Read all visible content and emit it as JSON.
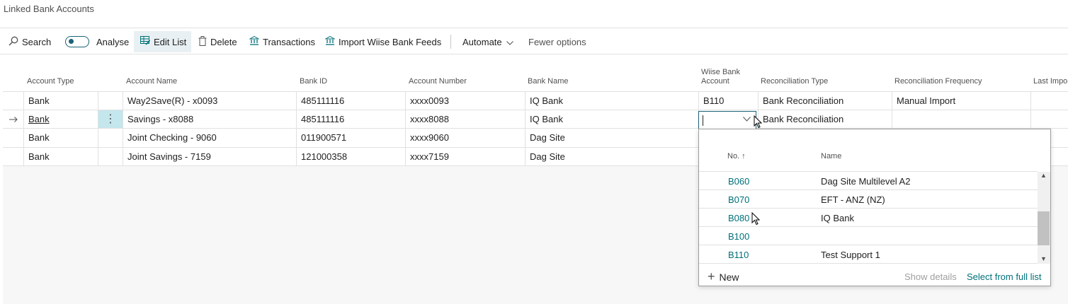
{
  "page": {
    "title": "Linked Bank Accounts"
  },
  "toolbar": {
    "search_label": "Search",
    "analyse_label": "Analyse",
    "edit_list_label": "Edit List",
    "delete_label": "Delete",
    "transactions_label": "Transactions",
    "import_label": "Import Wiise Bank Feeds",
    "automate_label": "Automate",
    "fewer_options_label": "Fewer options"
  },
  "grid": {
    "columns": {
      "account_type": "Account Type",
      "account_name": "Account Name",
      "bank_id": "Bank ID",
      "account_number": "Account Number",
      "bank_name": "Bank Name",
      "wiise_bank_account": "Wiise Bank Account",
      "reconciliation_type": "Reconciliation Type",
      "reconciliation_frequency": "Reconciliation Frequency",
      "last_import": "Last Impo"
    },
    "rows": [
      {
        "account_type": "Bank",
        "account_name": "Way2Save(R) - x0093",
        "bank_id": "485111116",
        "account_number": "xxxx0093",
        "bank_name": "IQ Bank",
        "wiise_bank_account": "B110",
        "reconciliation_type": "Bank Reconciliation",
        "reconciliation_frequency": "Manual Import"
      },
      {
        "account_type": "Bank",
        "account_name": "Savings - x8088",
        "bank_id": "485111116",
        "account_number": "xxxx8088",
        "bank_name": "IQ Bank",
        "wiise_bank_account": "",
        "reconciliation_type": "Bank Reconciliation",
        "reconciliation_frequency": ""
      },
      {
        "account_type": "Bank",
        "account_name": "Joint Checking - 9060",
        "bank_id": "011900571",
        "account_number": "xxxx9060",
        "bank_name": "Dag Site",
        "wiise_bank_account": "",
        "reconciliation_type": "",
        "reconciliation_frequency": ""
      },
      {
        "account_type": "Bank",
        "account_name": "Joint Savings - 7159",
        "bank_id": "121000358",
        "account_number": "xxxx7159",
        "bank_name": "Dag Site",
        "wiise_bank_account": "",
        "reconciliation_type": "",
        "reconciliation_frequency": ""
      }
    ]
  },
  "dropdown": {
    "col_no": "No. ↑",
    "col_name": "Name",
    "rows": [
      {
        "no": "B060",
        "name": "Dag Site Multilevel A2"
      },
      {
        "no": "B070",
        "name": "EFT - ANZ (NZ)"
      },
      {
        "no": "B080",
        "name": "IQ Bank"
      },
      {
        "no": "B100",
        "name": ""
      },
      {
        "no": "B110",
        "name": "Test Support 1"
      }
    ],
    "new_label": "New",
    "show_details_label": "Show details",
    "select_full_list_label": "Select from full list"
  },
  "icons": {
    "search": "search-icon",
    "edit_list": "edit-list-icon",
    "delete": "trash-icon",
    "transactions": "bank-icon",
    "import": "bank-import-icon"
  },
  "colors": {
    "accent": "#00707a",
    "selection": "#c4e6ed",
    "active_button": "#e8f0f3"
  }
}
